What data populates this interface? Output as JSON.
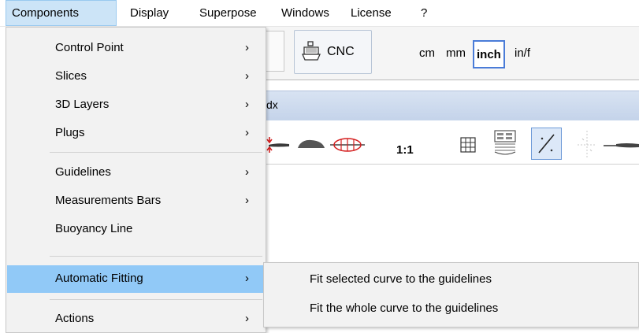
{
  "menubar": {
    "items": [
      {
        "label": "Components",
        "active": true
      },
      {
        "label": "Display"
      },
      {
        "label": "Superpose"
      },
      {
        "label": "Windows"
      },
      {
        "label": "License"
      },
      {
        "label": "?"
      }
    ]
  },
  "toolbar": {
    "cnc_label": "CNC",
    "units": [
      "cm",
      "mm",
      "inch",
      "in/f"
    ],
    "selected_unit": "inch",
    "tab_fragment": "dx",
    "scale_label": "1:1"
  },
  "components_menu": {
    "items": [
      {
        "label": "Control Point",
        "arrow": "›"
      },
      {
        "label": "Slices",
        "arrow": "›"
      },
      {
        "label": "3D Layers",
        "arrow": "›"
      },
      {
        "label": "Plugs",
        "arrow": "›"
      },
      {
        "label": "Guidelines",
        "arrow": "›"
      },
      {
        "label": "Measurements Bars",
        "arrow": "›"
      },
      {
        "label": "Buoyancy Line",
        "arrow": ""
      },
      {
        "label": "Automatic Fitting",
        "arrow": "›",
        "highlighted": true
      },
      {
        "label": "Actions",
        "arrow": "›"
      }
    ]
  },
  "automatic_fitting_submenu": {
    "items": [
      {
        "label": "Fit selected curve to the guidelines"
      },
      {
        "label": "Fit the whole curve to the guidelines"
      }
    ]
  },
  "colors": {
    "menu_highlight": "#91c9f7",
    "menubar_active": "#cce4f7",
    "selected_unit_border": "#4a7cd8",
    "title_bar": "#c4d3ea"
  }
}
